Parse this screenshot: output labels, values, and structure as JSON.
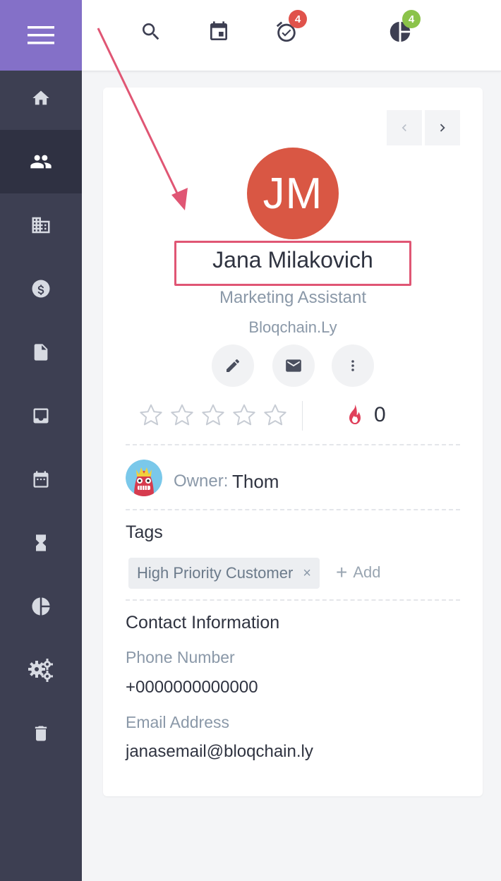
{
  "topbar": {
    "tasks_badge": "4",
    "reports_badge": "4"
  },
  "contact": {
    "initials": "JM",
    "name": "Jana Milakovich",
    "job_title": "Marketing Assistant",
    "company": "Bloqchain.Ly",
    "rating": 0,
    "rating_max": 5,
    "hotness": "0"
  },
  "owner": {
    "label": "Owner:",
    "name": "Thom"
  },
  "tags": {
    "title": "Tags",
    "items": [
      {
        "label": "High Priority Customer",
        "remove": "×"
      }
    ],
    "add_label": "Add",
    "add_plus": "+"
  },
  "contact_info": {
    "title": "Contact Information",
    "phone_label": "Phone Number",
    "phone_value": "+0000000000000",
    "email_label": "Email Address",
    "email_value": "janasemail@bloqchain.ly"
  },
  "icons": {
    "sidebar": [
      "home-icon",
      "people-icon",
      "building-icon",
      "dollar-icon",
      "document-icon",
      "inbox-icon",
      "calendar-icon",
      "hourglass-icon",
      "pie-chart-icon",
      "gears-icon",
      "trash-icon"
    ],
    "topbar": [
      "search-icon",
      "calendar-event-icon",
      "alarm-check-icon",
      "pie-chart-icon"
    ]
  },
  "colors": {
    "sidebar": "#3d3f52",
    "menu_accent": "#8470c8",
    "avatar": "#d95744",
    "badge_red": "#e0524b",
    "badge_green": "#8bc34a",
    "highlight": "#e05674"
  }
}
